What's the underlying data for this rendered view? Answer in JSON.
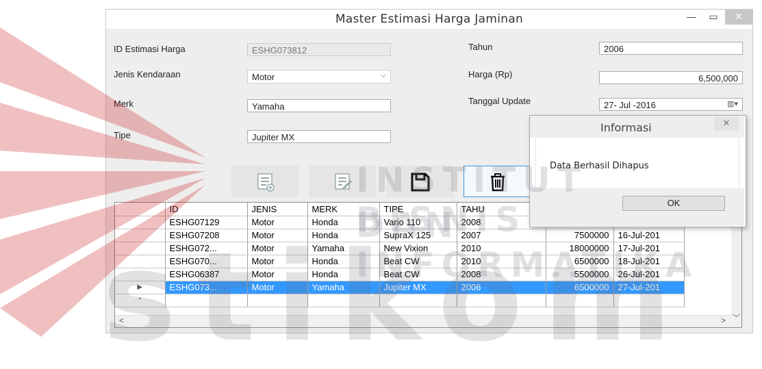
{
  "window": {
    "title": "Master Estimasi Harga Jaminan",
    "minimize_glyph": "—",
    "maximize_glyph": "▭",
    "close_glyph": "✕"
  },
  "form": {
    "id_label": "ID Estimasi Harga",
    "id_value": "ESHG073812",
    "jenis_label": "Jenis Kendaraan",
    "jenis_value": "Motor",
    "merk_label": "Merk",
    "merk_value": "Yamaha",
    "tipe_label": "Tipe",
    "tipe_value": "Jupiter MX",
    "tahun_label": "Tahun",
    "tahun_value": "2006",
    "harga_label": "Harga (Rp)",
    "harga_value": "6,500,000",
    "tanggal_label": "Tanggal Update",
    "tanggal_value": "27- Jul -2016"
  },
  "toolbar": {
    "icons": [
      "add-record-icon",
      "edit-record-icon",
      "save-icon",
      "delete-icon"
    ]
  },
  "grid": {
    "columns": [
      "ID",
      "JENIS",
      "MERK",
      "TIPE",
      "TAHU"
    ],
    "rows": [
      {
        "id": "ESHG07129",
        "jenis": "Motor",
        "merk": "Honda",
        "tipe": "Vario 110",
        "tahun": "2008",
        "harga": "",
        "tanggal": ""
      },
      {
        "id": "ESHG07208",
        "jenis": "Motor",
        "merk": "Honda",
        "tipe": "SupraX 125",
        "tahun": "2007",
        "harga": "7500000",
        "tanggal": "16-Jul-201"
      },
      {
        "id": "ESHG072...",
        "jenis": "Motor",
        "merk": "Yamaha",
        "tipe": "New Vixion",
        "tahun": "2010",
        "harga": "18000000",
        "tanggal": "17-Jul-201"
      },
      {
        "id": "ESHG070...",
        "jenis": "Motor",
        "merk": "Honda",
        "tipe": "Beat CW",
        "tahun": "2010",
        "harga": "6500000",
        "tanggal": "18-Jul-201"
      },
      {
        "id": "ESHG06387",
        "jenis": "Motor",
        "merk": "Honda",
        "tipe": "Beat CW",
        "tahun": "2008",
        "harga": "5500000",
        "tanggal": "26-Jul-201"
      },
      {
        "id": "ESHG073...",
        "jenis": "Motor",
        "merk": "Yamaha",
        "tipe": "Jupiter MX",
        "tahun": "2006",
        "harga": "6500000",
        "tanggal": "27-Jul-201"
      }
    ],
    "selected_row_marker": "▶",
    "new_row_marker": "*",
    "scroll_left": "<",
    "scroll_right": ">",
    "scroll_down": "﹀"
  },
  "dialog": {
    "title": "Informasi",
    "message": "Data Berhasil Dihapus",
    "ok_label": "OK",
    "close_glyph": "✕"
  },
  "watermark": {
    "line1": "INSTITUT BISNIS",
    "line2": "DAN INFORMATIKA",
    "brand": "stikom"
  },
  "colors": {
    "selection": "#3399ff",
    "accent_border": "#3c94dc"
  }
}
